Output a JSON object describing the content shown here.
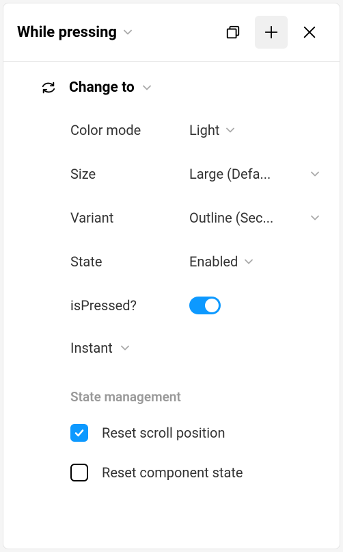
{
  "header": {
    "title": "While pressing"
  },
  "action": {
    "title": "Change to"
  },
  "props": {
    "colorMode": {
      "label": "Color mode",
      "value": "Light"
    },
    "size": {
      "label": "Size",
      "value": "Large (Defa..."
    },
    "variant": {
      "label": "Variant",
      "value": "Outline (Sec..."
    },
    "state": {
      "label": "State",
      "value": "Enabled"
    },
    "isPressed": {
      "label": "isPressed?"
    }
  },
  "animation": {
    "label": "Instant"
  },
  "stateManagement": {
    "sectionLabel": "State management",
    "resetScroll": {
      "label": "Reset scroll position"
    },
    "resetComponent": {
      "label": "Reset component state"
    }
  }
}
